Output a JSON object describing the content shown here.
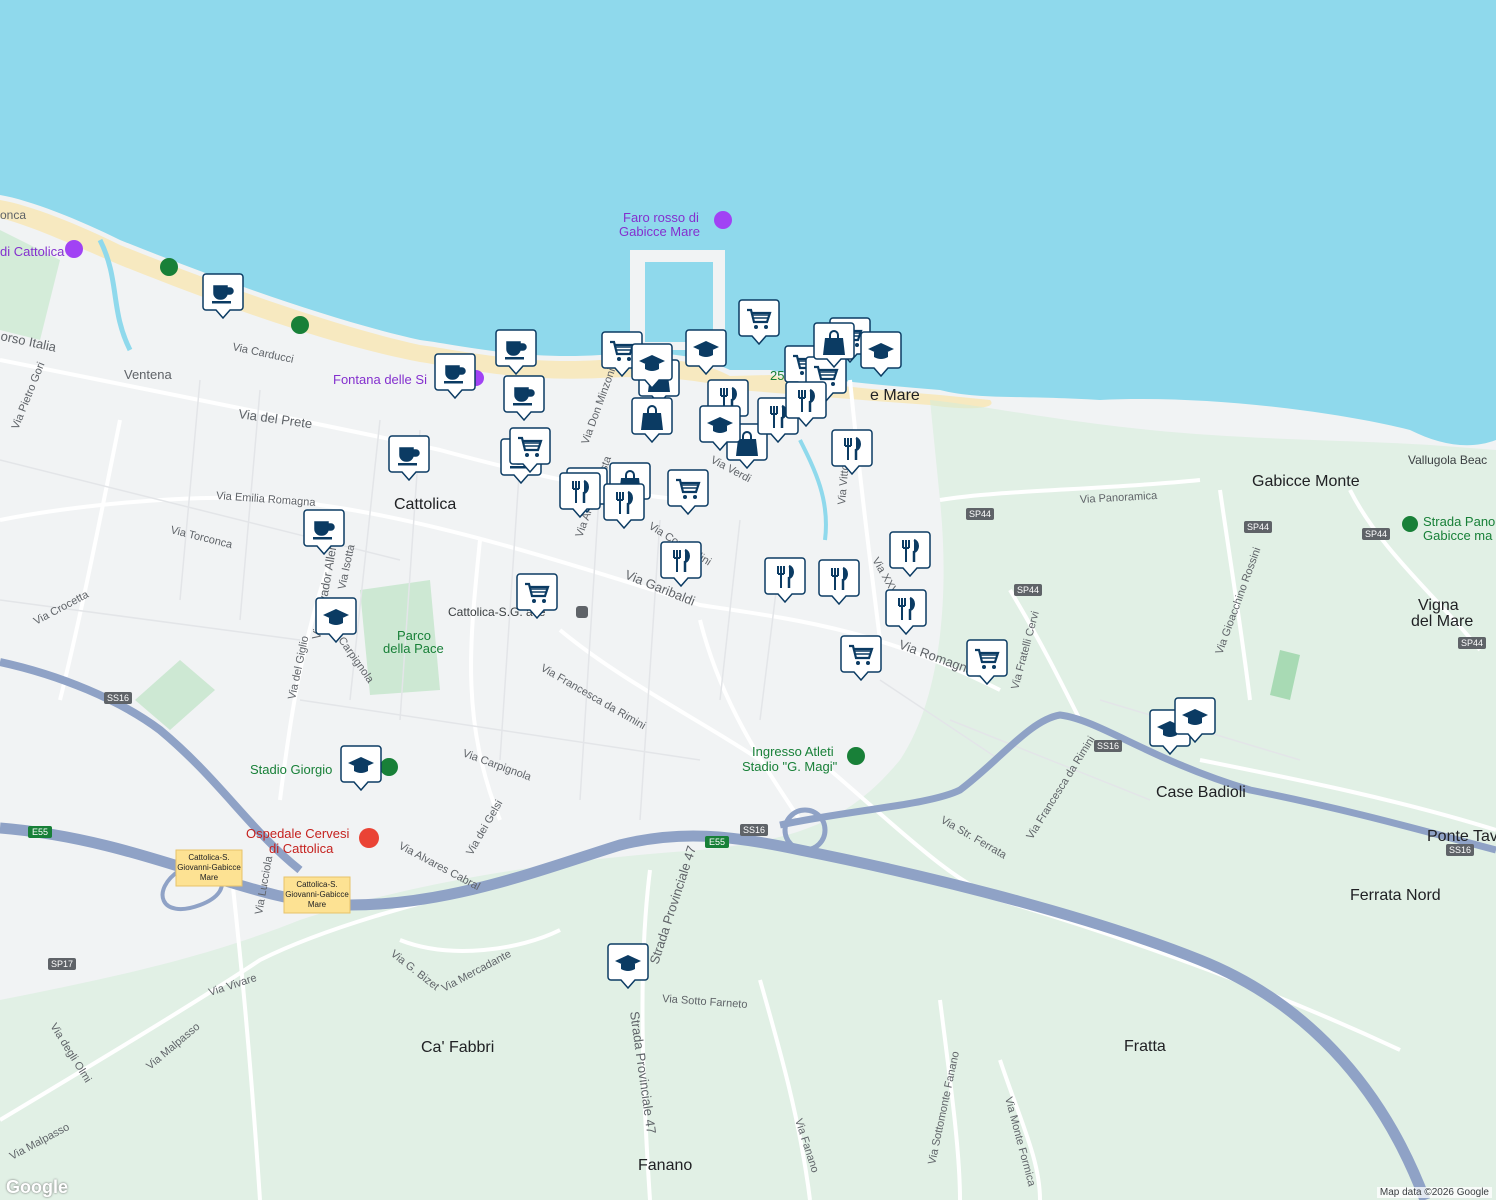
{
  "map": {
    "places": [
      {
        "id": "cattolica",
        "text": "Cattolica"
      },
      {
        "id": "gabicce-monte",
        "text": "Gabicce Monte"
      },
      {
        "id": "vigna-1",
        "text": "Vigna"
      },
      {
        "id": "vigna-2",
        "text": "del Mare"
      },
      {
        "id": "case-badioli",
        "text": "Case Badioli"
      },
      {
        "id": "ferrata-nord",
        "text": "Ferrata Nord"
      },
      {
        "id": "fratta",
        "text": "Fratta"
      },
      {
        "id": "ca-fabbri",
        "text": "Ca' Fabbri"
      },
      {
        "id": "fanano",
        "text": "Fanano"
      },
      {
        "id": "ventena",
        "text": "Ventena"
      },
      {
        "id": "ponte-tav",
        "text": "Ponte Tav"
      },
      {
        "id": "gabicce-mare",
        "text": "e Mare"
      },
      {
        "id": "25-ga",
        "text": "25 Ga"
      }
    ],
    "streets": [
      {
        "id": "via-carducci",
        "text": "Via Carducci"
      },
      {
        "id": "via-del-prete",
        "text": "Via del Prete"
      },
      {
        "id": "via-emilia-romagna",
        "text": "Via Emilia Romagna"
      },
      {
        "id": "via-torconca",
        "text": "Via Torconca"
      },
      {
        "id": "via-crocetta",
        "text": "Via Crocetta"
      },
      {
        "id": "via-garibaldi",
        "text": "Via Garibaldi"
      },
      {
        "id": "via-romagna",
        "text": "Via Romagna"
      },
      {
        "id": "via-panoramica",
        "text": "Via Panoramica"
      },
      {
        "id": "via-francesca-da-rimini",
        "text": "Via Francesca da Rimini"
      },
      {
        "id": "via-francesca-da-rimini-2",
        "text": "Via Francesca da Rimini"
      },
      {
        "id": "via-carpignola",
        "text": "Via Carpignola"
      },
      {
        "id": "via-dei-gelsi",
        "text": "Via dei Gelsi"
      },
      {
        "id": "via-alvares-cabral",
        "text": "Via Alvares Cabral"
      },
      {
        "id": "via-g-bizet",
        "text": "Via G. Bizet"
      },
      {
        "id": "via-mercadante",
        "text": "Via Mercadante"
      },
      {
        "id": "via-vivare",
        "text": "Via Vivare"
      },
      {
        "id": "via-malpasso",
        "text": "Via Malpasso"
      },
      {
        "id": "via-malpasso-2",
        "text": "Via Malpasso"
      },
      {
        "id": "via-degli-olmi",
        "text": "Via degli Olmi"
      },
      {
        "id": "via-lucciola",
        "text": "Via Lucciola"
      },
      {
        "id": "via-str-ferrata",
        "text": "Via Str. Ferrata"
      },
      {
        "id": "via-sotto-farneto",
        "text": "Via Sotto Farneto"
      },
      {
        "id": "via-fanano",
        "text": "Via Fanano"
      },
      {
        "id": "via-sottomonte-fanano",
        "text": "Via Sottomonte Fanano"
      },
      {
        "id": "via-monte-formica",
        "text": "Via Monte Formica"
      },
      {
        "id": "strada-provinciale-47",
        "text": "Strada Provinciale 47"
      },
      {
        "id": "strada-provinciale-47-b",
        "text": "Strada Provinciale 47"
      },
      {
        "id": "via-verdi",
        "text": "Via Verdi"
      },
      {
        "id": "via-salvador-allende",
        "text": "Via Salvador Allende"
      },
      {
        "id": "via-del-giglio",
        "text": "Via del Giglio"
      },
      {
        "id": "via-isotta",
        "text": "Via Isotta"
      },
      {
        "id": "via-pietro-gori",
        "text": "Via Pietro Gori"
      },
      {
        "id": "corso-italia",
        "text": "orso Italia"
      },
      {
        "id": "via-gioacchino-rossini",
        "text": "Via Gioacchino Rossini"
      },
      {
        "id": "via-fratelli-cervi",
        "text": "Via Fratelli Cervi"
      },
      {
        "id": "via-xxv-aprile",
        "text": "Via XXV Aprile"
      },
      {
        "id": "via-vittoria",
        "text": "Via Vittoria"
      },
      {
        "id": "via-don-minzoni",
        "text": "Via Don Minzoni"
      },
      {
        "id": "via-andrea-costa",
        "text": "Via Andrea Costa"
      },
      {
        "id": "via-comandini",
        "text": "Via Comandini"
      },
      {
        "id": "carpignola-b",
        "text": "Carpignola"
      }
    ],
    "pois": [
      {
        "id": "faro-1",
        "text": "Faro rosso di"
      },
      {
        "id": "faro-2",
        "text": "Gabicce Mare"
      },
      {
        "id": "fontana",
        "text": "Fontana delle Si"
      },
      {
        "id": "di-cattolica",
        "text": "di Cattolica"
      },
      {
        "id": "parco-1",
        "text": "Parco"
      },
      {
        "id": "parco-2",
        "text": "della Pace"
      },
      {
        "id": "stadio-giorgio",
        "text": "Stadio Giorgio"
      },
      {
        "id": "ospedale-1",
        "text": "Ospedale Cervesi"
      },
      {
        "id": "ospedale-2",
        "text": "di Cattolica"
      },
      {
        "id": "ingresso-1",
        "text": "Ingresso Atleti"
      },
      {
        "id": "ingresso-2",
        "text": "Stadio \"G. Magi\""
      },
      {
        "id": "station",
        "text": "Cattolica-S.G.   ace"
      },
      {
        "id": "strada-panoramica-1",
        "text": "Strada Pano"
      },
      {
        "id": "strada-panoramica-2",
        "text": "Gabicce ma"
      },
      {
        "id": "vallugola",
        "text": "Vallugola Beac"
      },
      {
        "id": "conca",
        "text": "onca"
      }
    ],
    "shields": [
      {
        "id": "sp44-a",
        "text": "SP44"
      },
      {
        "id": "sp44-b",
        "text": "SP44"
      },
      {
        "id": "sp44-c",
        "text": "SP44"
      },
      {
        "id": "sp44-d",
        "text": "SP44"
      },
      {
        "id": "sp44-e",
        "text": "SP44"
      },
      {
        "id": "ss16-a",
        "text": "SS16"
      },
      {
        "id": "ss16-b",
        "text": "SS16"
      },
      {
        "id": "ss16-c",
        "text": "SS16"
      },
      {
        "id": "ss16-d",
        "text": "SS16"
      },
      {
        "id": "e55-a",
        "text": "E55"
      },
      {
        "id": "e55-b",
        "text": "E55"
      },
      {
        "id": "sp17",
        "text": "SP17"
      }
    ],
    "exits": [
      {
        "id": "exit-1",
        "lines": [
          "Cattolica-S.",
          "Giovanni-Gabicce",
          "Mare"
        ]
      },
      {
        "id": "exit-2",
        "lines": [
          "Cattolica-S.",
          "Giovanni-Gabicce",
          "Mare"
        ]
      }
    ],
    "markers": [
      {
        "type": "cafe"
      },
      {
        "type": "cafe"
      },
      {
        "type": "cafe"
      },
      {
        "type": "cafe"
      },
      {
        "type": "cafe"
      },
      {
        "type": "cafe"
      },
      {
        "type": "cafe"
      },
      {
        "type": "grocery"
      },
      {
        "type": "grocery"
      },
      {
        "type": "grocery"
      },
      {
        "type": "grocery"
      },
      {
        "type": "grocery"
      },
      {
        "type": "grocery"
      },
      {
        "type": "grocery"
      },
      {
        "type": "grocery"
      },
      {
        "type": "grocery"
      },
      {
        "type": "grocery"
      },
      {
        "type": "shopping"
      },
      {
        "type": "shopping"
      },
      {
        "type": "shopping"
      },
      {
        "type": "shopping"
      },
      {
        "type": "shopping"
      },
      {
        "type": "shopping"
      },
      {
        "type": "restaurant"
      },
      {
        "type": "restaurant"
      },
      {
        "type": "restaurant"
      },
      {
        "type": "restaurant"
      },
      {
        "type": "restaurant"
      },
      {
        "type": "restaurant"
      },
      {
        "type": "restaurant"
      },
      {
        "type": "restaurant"
      },
      {
        "type": "restaurant"
      },
      {
        "type": "restaurant"
      },
      {
        "type": "restaurant"
      },
      {
        "type": "school"
      },
      {
        "type": "school"
      },
      {
        "type": "school"
      },
      {
        "type": "school"
      },
      {
        "type": "school"
      },
      {
        "type": "school"
      },
      {
        "type": "school"
      },
      {
        "type": "school"
      },
      {
        "type": "school"
      }
    ],
    "attribution": "Map data ©2026 Google",
    "logo": "Google",
    "colors": {
      "sea": "#8fd9ec",
      "land": "#f1f3f4",
      "green": "#d4ecd9",
      "beach": "#f7e9c0",
      "motorway": "#8fa2c6",
      "marker": "#0b3b63"
    }
  }
}
